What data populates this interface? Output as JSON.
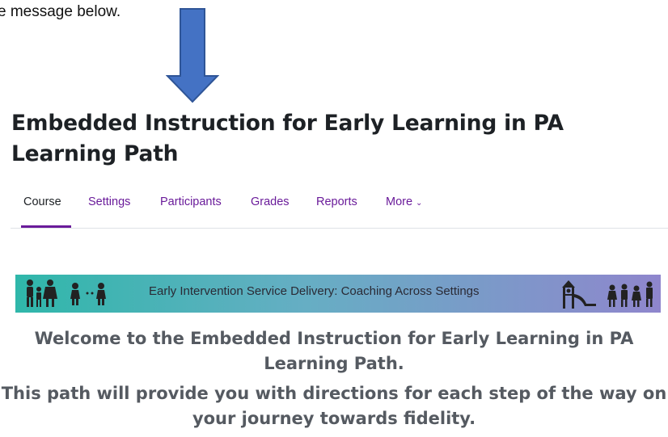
{
  "top_note": "e message below.",
  "course": {
    "title": "Embedded Instruction for Early Learning in PA Learning Path"
  },
  "nav": {
    "tabs": [
      {
        "label": "Course"
      },
      {
        "label": "Settings"
      },
      {
        "label": "Participants"
      },
      {
        "label": "Grades"
      },
      {
        "label": "Reports"
      },
      {
        "label": "More"
      }
    ],
    "active_tab": "Course"
  },
  "banner": {
    "text": "Early Intervention Service Delivery: Coaching Across Settings",
    "icons": [
      "family-icon",
      "playing-children-icon",
      "playground-slide-icon",
      "children-group-icon"
    ]
  },
  "welcome": {
    "line1": "Welcome to the Embedded Instruction for Early Learning in PA Learning Path.",
    "line2": "This path will provide you with directions for each step of the way on your journey towards fidelity."
  },
  "colors": {
    "accent": "#6a1b9a",
    "arrow_fill": "#4472c4",
    "arrow_stroke": "#2f5597",
    "heading": "#1d2125",
    "welcome_text": "#555a61"
  }
}
